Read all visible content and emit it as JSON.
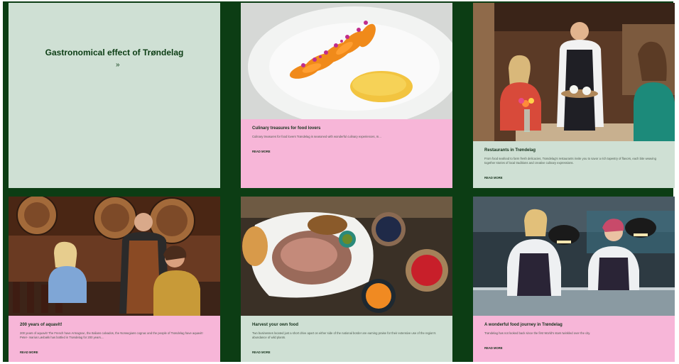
{
  "intro": {
    "title": "Gastronomical effect of Trøndelag",
    "arrow": "»"
  },
  "cards": [
    {
      "title": "Culinary treasures for food lovers",
      "text": "Culinary treasures for food lovers Trøndelag is seasoned with wonderful culinary experiences, m...",
      "link": "READ MORE",
      "caption_color": "#f7b6d8"
    },
    {
      "title": "Restaurants in Trøndelag",
      "text": "From food seafood to farm fresh delicacies, Trøndelag's restaurants invite you to savor a rich tapestry of flavors, each bite weaving together stories of local traditions and creative culinary expressions.",
      "link": "READ MORE",
      "caption_color": "#cfe0d4"
    },
    {
      "title": "200 years of aquavit!",
      "text": "200 years of aquavit! The French have Armagnac, the Italians calvados, the Norwegians cognac and the people of Trøndelag have aquavit! Peter- marius Løvbakk has bottled in Trøndelag for 200 years....",
      "link": "READ MORE",
      "caption_color": "#f7b6d8"
    },
    {
      "title": "Harvest your own food",
      "text": "Two businesses located just a short drive apart on either side of the national border are earning praise for their extensive use of the region's abundance of wild plants.",
      "link": "READ MORE",
      "caption_color": "#cfe0d4"
    },
    {
      "title": "A wonderful food journey in Trøndelag",
      "text": "Trøndelag has not looked back since the first World's stars twinkled over the city.",
      "link": "READ MORE",
      "caption_color": "#f7b6d8"
    }
  ],
  "colors": {
    "frame": "#0c3d14",
    "sage": "#cfe0d4",
    "pink": "#f7b6d8"
  },
  "images": [
    "plated-dish-image",
    "restaurant-waiter-image",
    "aquavit-cellar-image",
    "wild-harvest-food-image",
    "chefs-kitchen-image"
  ]
}
